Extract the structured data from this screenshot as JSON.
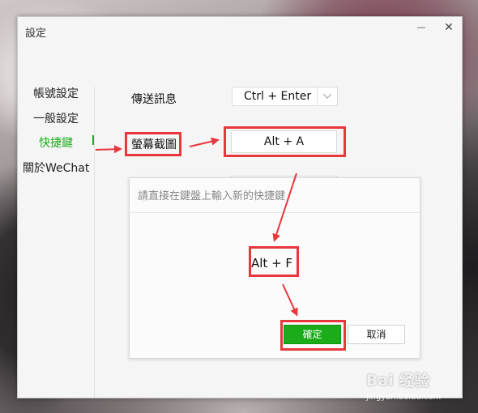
{
  "window": {
    "title": "設定",
    "minimize_glyph": "—",
    "close_glyph": "✕"
  },
  "sidebar": {
    "items": [
      {
        "label": "帳號設定",
        "active": false
      },
      {
        "label": "一般設定",
        "active": false
      },
      {
        "label": "快捷鍵",
        "active": true
      },
      {
        "label": "關於WeChat",
        "active": false
      }
    ],
    "active_color": "#1aad19"
  },
  "shortcuts": {
    "send_label": "傳送訊息",
    "send_value": "Ctrl + Enter",
    "screenshot_label": "螢幕截圖",
    "screenshot_value": "Alt + A"
  },
  "dialog": {
    "hint": "請直接在鍵盤上輸入新的快捷鍵",
    "new_key": "Alt + F",
    "confirm_label": "確定",
    "cancel_label": "取消"
  },
  "annotation": {
    "highlight_color": "#e8383d"
  },
  "watermark": {
    "text": "Bai 经验",
    "sub": "jingyan.baidu.com"
  }
}
